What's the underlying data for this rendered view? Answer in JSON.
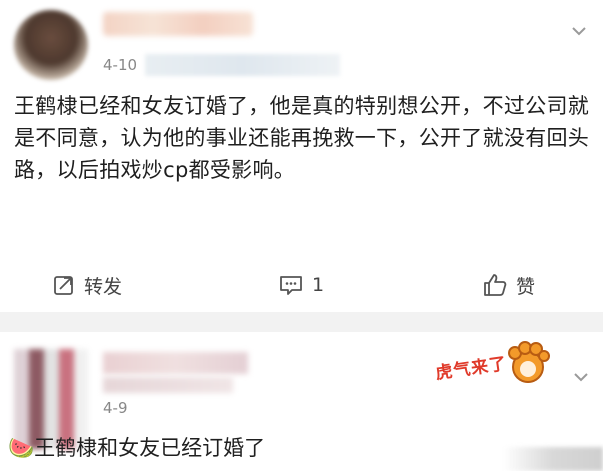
{
  "post1": {
    "date": "4-10",
    "text": "王鹤棣已经和女友订婚了，他是真的特别想公开，不过公司就是不同意，认为他的事业还能再挽救一下，公开了就没有回头路，以后拍戏炒cp都受影响。",
    "actions": {
      "repost_label": "转发",
      "comment_count": "1",
      "like_label": "赞"
    }
  },
  "post2": {
    "date": "4-9",
    "text": "王鹤棣和女友已经订婚了",
    "sticker_text": "虎气来了",
    "emoji": "🍉"
  },
  "icons": {
    "repost": "repost-icon",
    "comment": "comment-icon",
    "like": "thumbs-up-icon",
    "chevron": "chevron-down-icon"
  }
}
